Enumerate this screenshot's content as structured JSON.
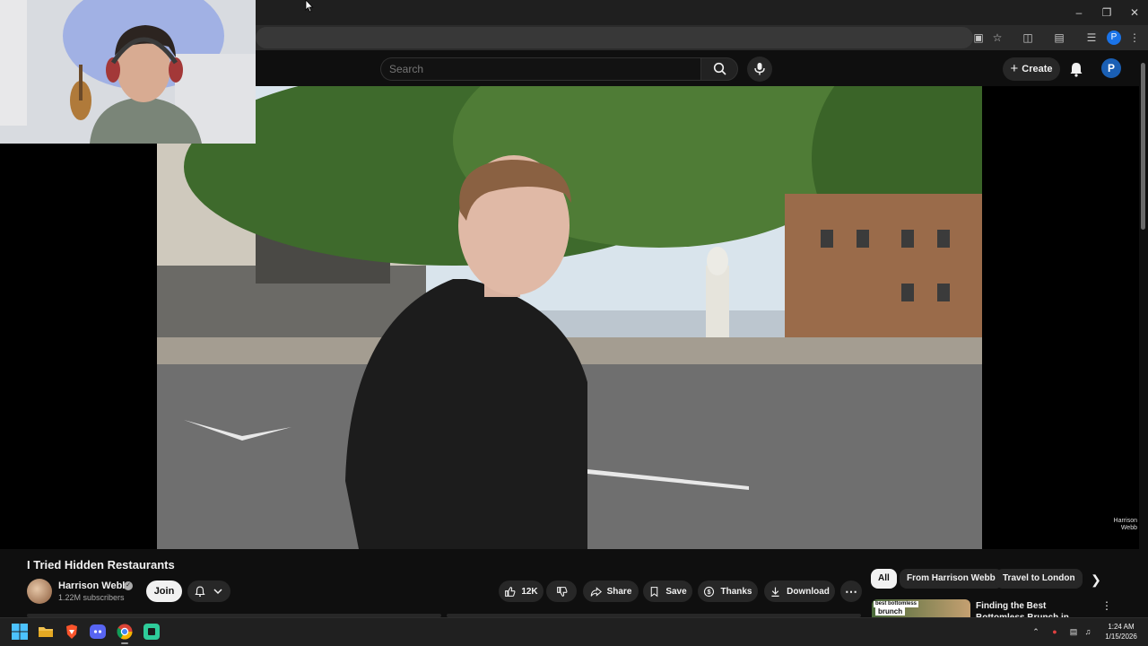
{
  "browser": {
    "window_controls": [
      "minimize",
      "restore",
      "close"
    ],
    "profile_initial": "P"
  },
  "masthead": {
    "search_placeholder": "Search",
    "create_label": "Create",
    "avatar_initial": "P"
  },
  "video": {
    "title": "I Tried Hidden Restaurants",
    "watermark": "Harrison Webb"
  },
  "channel": {
    "name": "Harrison Webb",
    "subscribers": "1.22M subscribers",
    "join_label": "Join"
  },
  "actions": {
    "like_count": "12K",
    "share_label": "Share",
    "save_label": "Save",
    "thanks_label": "Thanks",
    "download_label": "Download"
  },
  "chips": [
    "All",
    "From Harrison Webb",
    "Travel to London"
  ],
  "related": {
    "title": "Finding the Best Bottomless Brunch in London",
    "thumb_small": "best bottomless",
    "thumb_big": "brunch"
  },
  "taskbar": {
    "time": "1:24 AM",
    "date": "1/15/2026",
    "apps": [
      "windows-start",
      "file-explorer",
      "brave",
      "discord",
      "chrome",
      "app"
    ]
  },
  "colors": {
    "background": "#0f0f0f",
    "accent_blue": "#1a73e8",
    "chip_active": "#f1f1f1",
    "pill": "#272727"
  }
}
